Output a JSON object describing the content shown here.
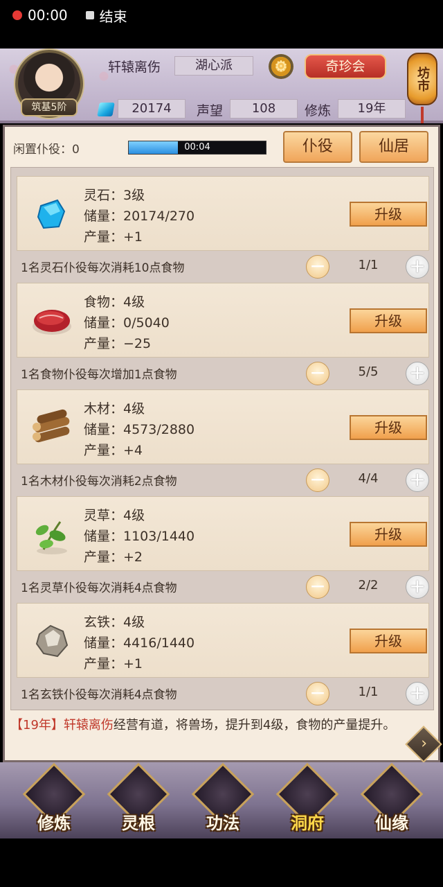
{
  "status_bar": {
    "time": "00:00",
    "end_label": "结束"
  },
  "header": {
    "player_name": "轩辕离伤",
    "sect": "湖心派",
    "rank": "筑基5阶",
    "market_button": "奇珍会",
    "lantern_label": "坊市",
    "spirit_stone": "20174",
    "reputation_label": "声望",
    "reputation": "108",
    "cultivation_label": "修炼",
    "cultivation": "19年"
  },
  "panel": {
    "idle_servants": "闲置仆役：0",
    "timer": "00:04",
    "timer_progress": 0.36,
    "servant_button": "仆役",
    "residence_button": "仙居",
    "resources": [
      {
        "icon": "spirit-stone-icon",
        "name": "灵石：3级",
        "storage": "储量：20174/270",
        "output": "产量：+1",
        "upgrade": "升级",
        "note": "1名灵石仆役每次消耗10点食物",
        "count": "1/1"
      },
      {
        "icon": "meat-icon",
        "name": "食物：4级",
        "storage": "储量：0/5040",
        "output": "产量：−25",
        "upgrade": "升级",
        "note": "1名食物仆役每次增加1点食物",
        "count": "5/5"
      },
      {
        "icon": "wood-logs-icon",
        "name": "木材：4级",
        "storage": "储量：4573/2880",
        "output": "产量：+4",
        "upgrade": "升级",
        "note": "1名木材仆役每次消耗2点食物",
        "count": "4/4"
      },
      {
        "icon": "herb-icon",
        "name": "灵草：4级",
        "storage": "储量：1103/1440",
        "output": "产量：+2",
        "upgrade": "升级",
        "note": "1名灵草仆役每次消耗4点食物",
        "count": "2/2"
      },
      {
        "icon": "iron-ore-icon",
        "name": "玄铁：4级",
        "storage": "储量：4416/1440",
        "output": "产量：+1",
        "upgrade": "升级",
        "note": "1名玄铁仆役每次消耗4点食物",
        "count": "1/1"
      }
    ],
    "log": {
      "bracket_open": "【",
      "year": "19年",
      "bracket_close": "】",
      "actor": "轩辕离伤",
      "text": "经营有道，将兽场，提升到4级，食物的产量提升。"
    }
  },
  "nav": {
    "items": [
      {
        "label": "修炼",
        "icon": "cultivate-icon"
      },
      {
        "label": "灵根",
        "icon": "spirit-root-icon"
      },
      {
        "label": "功法",
        "icon": "technique-book-icon"
      },
      {
        "label": "洞府",
        "icon": "cave-abode-icon"
      },
      {
        "label": "仙缘",
        "icon": "gourd-icon"
      }
    ],
    "active_index": 3
  },
  "colors": {
    "upgrade_button": "#f0a04c",
    "header_bg": "#c4b8cf",
    "panel_bg": "#f6ecdf",
    "highlight_red": "#c0392b",
    "progress_fill": "#2b8fe0"
  }
}
